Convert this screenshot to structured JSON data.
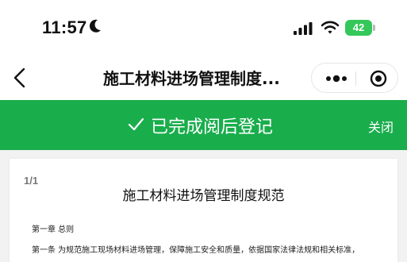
{
  "status_bar": {
    "time": "11:57",
    "battery": "42"
  },
  "nav": {
    "title": "施工材料进场管理制度..."
  },
  "banner": {
    "text": "已完成阅后登记",
    "close_label": "关闭",
    "color": "#1aad4c"
  },
  "document": {
    "page_indicator": "1/1",
    "title": "施工材料进场管理制度规范",
    "chapter": "第一章   总则",
    "article_1": "第一条   为规范施工现场材料进场管理，保障施工安全和质量，依据国家法律法规和相关标准，"
  },
  "icons": [
    "moon-icon",
    "signal-icon",
    "wifi-icon",
    "back-arrow-icon",
    "more-dots-icon",
    "close-miniprogram-icon",
    "check-icon"
  ]
}
